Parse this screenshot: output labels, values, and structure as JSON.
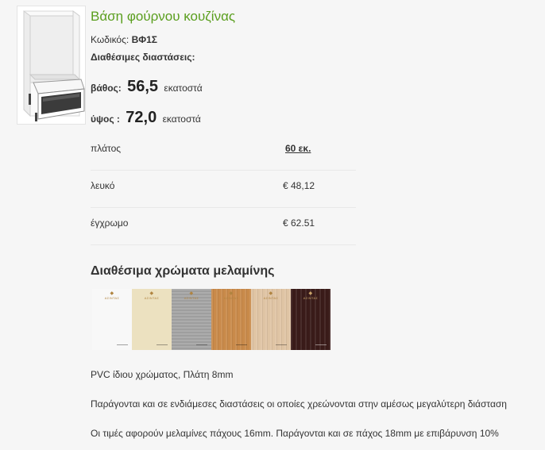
{
  "product": {
    "title": "Βάση φούρνου κουζίνας",
    "code_label": "Κωδικός:",
    "code": "ΒΦ1Σ",
    "dims_label": "Διαθέσιμες διαστάσεις:",
    "depth_label": "βάθος:",
    "depth_value": "56,5",
    "height_label": "ύψος :",
    "height_value": "72,0",
    "unit": "εκατοστά"
  },
  "pricing": {
    "rows": [
      {
        "label": "πλάτος",
        "value": "60 εκ."
      },
      {
        "label": "λευκό",
        "value": "€ 48,12"
      },
      {
        "label": "έγχρωμο",
        "value": "€ 62.51"
      }
    ]
  },
  "colors": {
    "heading": "Διαθέσιμα χρώματα μελαμίνης",
    "logo_text": "ΑΣΙΝΤΑΣ",
    "swatches": [
      {
        "name": "white",
        "color": "#f8f8f8"
      },
      {
        "name": "cream",
        "color": "#ece1c0"
      },
      {
        "name": "grey",
        "color": "#a7a7a7"
      },
      {
        "name": "beech",
        "color": "#c98a4a"
      },
      {
        "name": "light-oak",
        "color": "#dfc4a4"
      },
      {
        "name": "wenge",
        "color": "#3a1b19"
      }
    ]
  },
  "notes": [
    "PVC ίδιου χρώματος, Πλάτη 8mm",
    "Παράγονται και σε ενδιάμεσες διαστάσεις οι οποίες χρεώνονται στην αμέσως μεγαλύτερη διάσταση",
    "Οι τιμές αφορούν μελαμίνες πάχους 16mm. Παράγονται και σε πάχος 18mm με επιβάρυνση 10%"
  ]
}
